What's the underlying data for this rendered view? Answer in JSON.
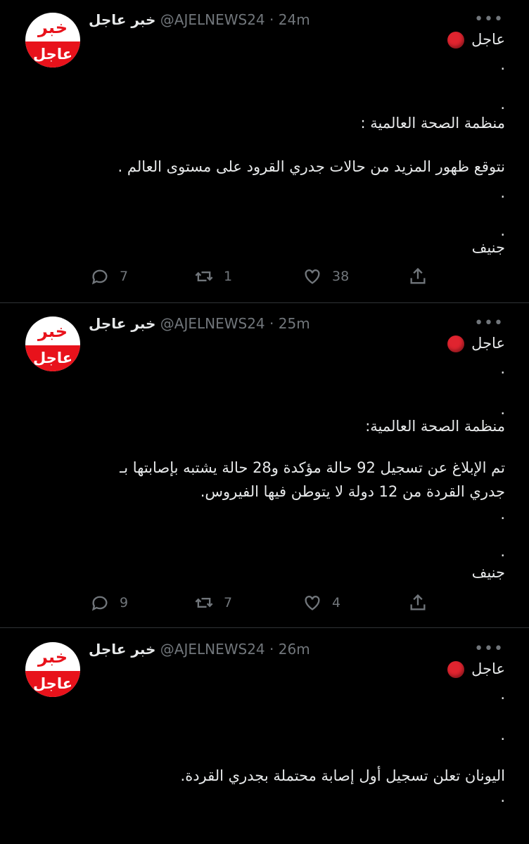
{
  "account": {
    "avatar_top": "خبر",
    "avatar_bottom": "عاجل",
    "name": "خبر عاجل",
    "handle": "@AJELNEWS24"
  },
  "separator": "·",
  "more_icon": "more-dots-icon",
  "tweets": [
    {
      "time": "24m",
      "lines": [
        "عاجل",
        ".",
        ".",
        "منظمة الصحة العالمية :",
        "نتوقع ظهور المزيد من حالات جدري القرود على مستوى العالم .",
        ".",
        ".",
        "جنيف"
      ],
      "replies": "7",
      "retweets": "1",
      "likes": "38"
    },
    {
      "time": "25m",
      "lines": [
        "عاجل",
        ".",
        ".",
        "منظمة الصحة العالمية:",
        "تم الإبلاغ عن تسجيل 92 حالة مؤكدة و28 حالة يشتبه بإصابتها بـ",
        "جدري القردة من 12 دولة لا يتوطن فيها الفيروس.",
        ".",
        ".",
        "جنيف"
      ],
      "replies": "9",
      "retweets": "7",
      "likes": "4"
    },
    {
      "time": "26m",
      "lines": [
        "عاجل",
        ".",
        ".",
        "اليونان تعلن تسجيل أول إصابة محتملة بجدري القردة.",
        "."
      ]
    }
  ],
  "icons": [
    "reply-icon",
    "retweet-icon",
    "like-icon",
    "share-icon"
  ],
  "colors": {
    "background": "#000000",
    "text": "#e7e9ea",
    "muted": "#71767b",
    "red": "#e8121b"
  }
}
